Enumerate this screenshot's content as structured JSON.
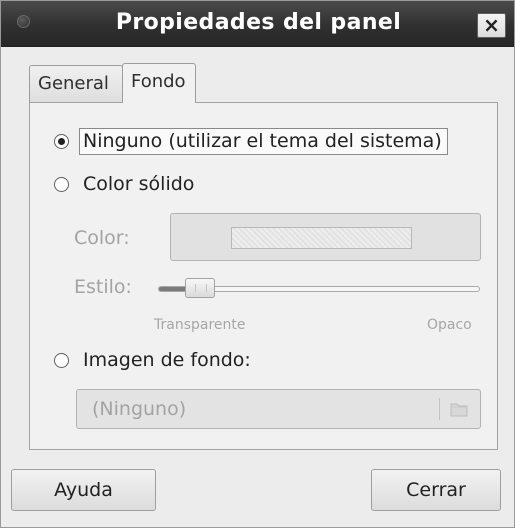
{
  "window": {
    "title": "Propiedades del panel",
    "close_glyph": "×"
  },
  "tabs": [
    {
      "label": "General"
    },
    {
      "label": "Fondo",
      "selected": true
    }
  ],
  "background": {
    "none_option": {
      "label": "Ninguno (utilizar el tema del sistema)",
      "selected": true
    },
    "solid_color_option": {
      "label": "Color sólido",
      "selected": false
    },
    "color_label": "Color:",
    "style_label": "Estilo:",
    "style_slider": {
      "value": 0.13,
      "min_label": "Transparente",
      "max_label": "Opaco"
    },
    "image_option": {
      "label": "Imagen de fondo:",
      "selected": false
    },
    "image_file_value": "(Ninguno)"
  },
  "buttons": {
    "help": "Ayuda",
    "close": "Cerrar"
  },
  "icons": {
    "title_orb": "window-menu-orb-icon",
    "close": "close-icon",
    "folder": "folder-icon"
  }
}
